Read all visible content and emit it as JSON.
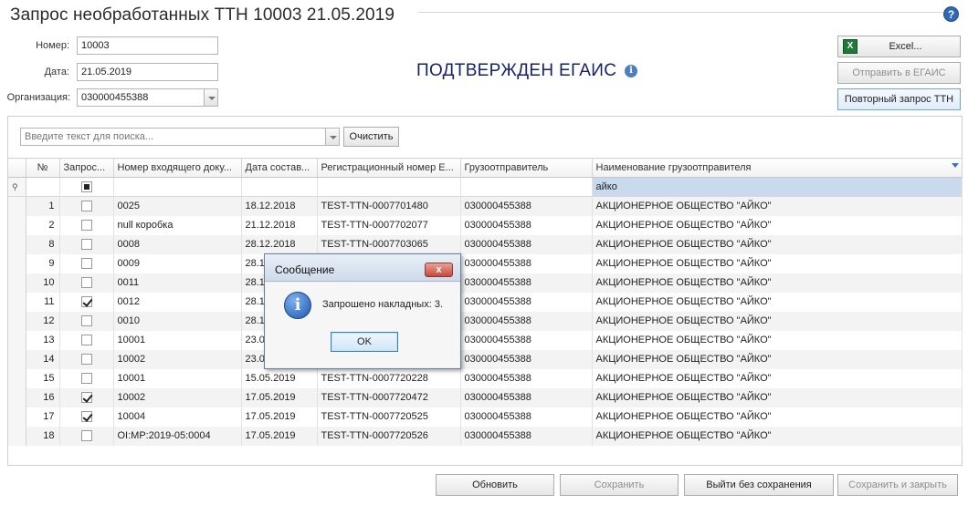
{
  "title": "Запрос необработанных ТТН 10003 21.05.2019",
  "help": "?",
  "form": {
    "number_label": "Номер:",
    "number_value": "10003",
    "date_label": "Дата:",
    "date_value": "21.05.2019",
    "org_label": "Организация:",
    "org_value": "030000455388"
  },
  "status": {
    "text": "ПОДТВЕРЖДЕН ЕГАИС",
    "info_icon": "i"
  },
  "actions": {
    "excel_label": "Excel...",
    "send_label": "Отправить в ЕГАИС",
    "repeat_label": "Повторный запрос ТТН"
  },
  "search": {
    "placeholder": "Введите текст для поиска...",
    "clear_label": "Очистить"
  },
  "table": {
    "columns": [
      "№",
      "Запрос...",
      "Номер входящего доку...",
      "Дата состав...",
      "Регистрационный номер Е...",
      "Грузоотправитель",
      "Наименование грузоотправителя"
    ],
    "filter_value": "айко",
    "rows": [
      {
        "n": "1",
        "checked": false,
        "doc": "0025",
        "date": "18.12.2018",
        "reg": "TEST-TTN-0007701480",
        "shipper": "030000455388",
        "name": "АКЦИОНЕРНОЕ ОБЩЕСТВО \"АЙКО\""
      },
      {
        "n": "2",
        "checked": false,
        "doc": "null коробка",
        "date": "21.12.2018",
        "reg": "TEST-TTN-0007702077",
        "shipper": "030000455388",
        "name": "АКЦИОНЕРНОЕ ОБЩЕСТВО \"АЙКО\""
      },
      {
        "n": "8",
        "checked": false,
        "doc": "0008",
        "date": "28.12.2018",
        "reg": "TEST-TTN-0007703065",
        "shipper": "030000455388",
        "name": "АКЦИОНЕРНОЕ ОБЩЕСТВО \"АЙКО\""
      },
      {
        "n": "9",
        "checked": false,
        "doc": "0009",
        "date": "28.1",
        "reg": "",
        "shipper": "030000455388",
        "name": "АКЦИОНЕРНОЕ ОБЩЕСТВО \"АЙКО\""
      },
      {
        "n": "10",
        "checked": false,
        "doc": "0011",
        "date": "28.1",
        "reg": "",
        "shipper": "030000455388",
        "name": "АКЦИОНЕРНОЕ ОБЩЕСТВО \"АЙКО\""
      },
      {
        "n": "11",
        "checked": true,
        "doc": "0012",
        "date": "28.1",
        "reg": "",
        "shipper": "030000455388",
        "name": "АКЦИОНЕРНОЕ ОБЩЕСТВО \"АЙКО\""
      },
      {
        "n": "12",
        "checked": false,
        "doc": "0010",
        "date": "28.1",
        "reg": "",
        "shipper": "030000455388",
        "name": "АКЦИОНЕРНОЕ ОБЩЕСТВО \"АЙКО\""
      },
      {
        "n": "13",
        "checked": false,
        "doc": "10001",
        "date": "23.0",
        "reg": "",
        "shipper": "030000455388",
        "name": "АКЦИОНЕРНОЕ ОБЩЕСТВО \"АЙКО\""
      },
      {
        "n": "14",
        "checked": false,
        "doc": "10002",
        "date": "23.0",
        "reg": "",
        "shipper": "030000455388",
        "name": "АКЦИОНЕРНОЕ ОБЩЕСТВО \"АЙКО\""
      },
      {
        "n": "15",
        "checked": false,
        "doc": "10001",
        "date": "15.05.2019",
        "reg": "TEST-TTN-0007720228",
        "shipper": "030000455388",
        "name": "АКЦИОНЕРНОЕ ОБЩЕСТВО \"АЙКО\""
      },
      {
        "n": "16",
        "checked": true,
        "doc": "10002",
        "date": "17.05.2019",
        "reg": "TEST-TTN-0007720472",
        "shipper": "030000455388",
        "name": "АКЦИОНЕРНОЕ ОБЩЕСТВО \"АЙКО\""
      },
      {
        "n": "17",
        "checked": true,
        "doc": "10004",
        "date": "17.05.2019",
        "reg": "TEST-TTN-0007720525",
        "shipper": "030000455388",
        "name": "АКЦИОНЕРНОЕ ОБЩЕСТВО \"АЙКО\""
      },
      {
        "n": "18",
        "checked": false,
        "doc": "OI:MP:2019-05:0004",
        "date": "17.05.2019",
        "reg": "TEST-TTN-0007720526",
        "shipper": "030000455388",
        "name": "АКЦИОНЕРНОЕ ОБЩЕСТВО \"АЙКО\""
      }
    ]
  },
  "dialog": {
    "title": "Сообщение",
    "close": "x",
    "message": "Запрошено накладных: 3.",
    "ok_label": "OK"
  },
  "bottom": {
    "refresh_label": "Обновить",
    "save_label": "Сохранить",
    "exit_label": "Выйти без сохранения",
    "save_close_label": "Сохранить и закрыть"
  },
  "icons": {
    "excel": "excel-icon",
    "help": "help-icon",
    "info": "info-icon",
    "pin": "pin-icon",
    "funnel": "filter-icon"
  }
}
